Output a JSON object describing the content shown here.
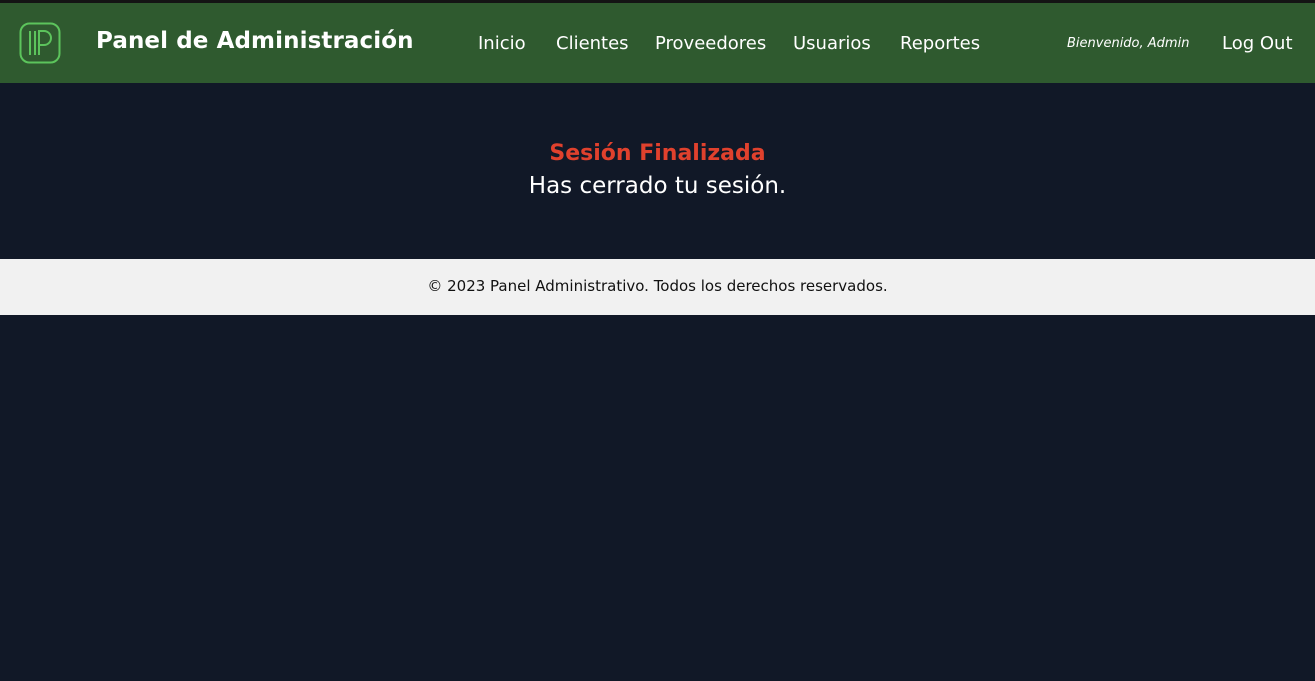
{
  "header": {
    "logo_icon": "p-logo-icon",
    "title": "Panel de Administración",
    "nav": [
      {
        "label": "Inicio"
      },
      {
        "label": "Clientes"
      },
      {
        "label": "Proveedores"
      },
      {
        "label": "Usuarios"
      },
      {
        "label": "Reportes"
      }
    ],
    "welcome": "Bienvenido, Admin",
    "logout_label": "Log Out"
  },
  "main": {
    "status_title": "Sesión Finalizada",
    "status_message": "Has cerrado tu sesión."
  },
  "footer": {
    "text": "© 2023 Panel Administrativo. Todos los derechos reservados."
  },
  "colors": {
    "header_bg": "#2f5a2f",
    "page_bg": "#111827",
    "footer_bg": "#f1f1f1",
    "status_title": "#e0412d",
    "logo_accent": "#5cc45c"
  }
}
